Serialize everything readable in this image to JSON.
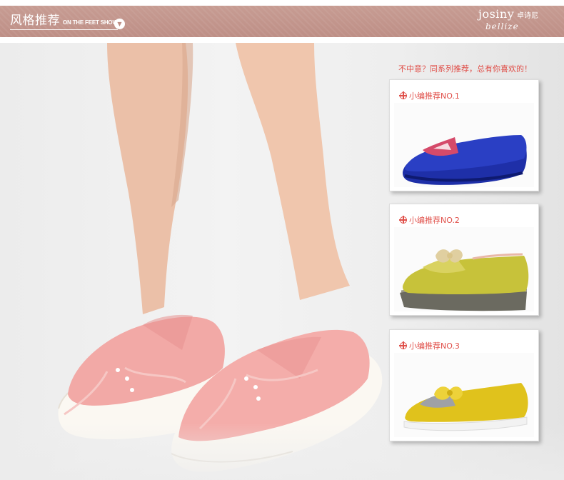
{
  "header": {
    "title": "风格推荐",
    "subtitle": "ON THE FEET SHOW",
    "arrow_icon": "chevron-down-icon",
    "brand_name": "JOSINY",
    "brand_cn": "卓诗尼",
    "brand_script": "bellize",
    "color": "#c49990"
  },
  "recommend": {
    "promo_text": "不中意？同系列推荐，总有你喜欢的！",
    "accent_color": "#e0504a",
    "cards": [
      {
        "label": "小编推荐NO.1",
        "shoe_color": "#2a3fc4"
      },
      {
        "label": "小编推荐NO.2",
        "shoe_color": "#c7c23a"
      },
      {
        "label": "小编推荐NO.3",
        "shoe_color": "#e0c21c"
      }
    ]
  },
  "hero": {
    "shoe_color": "#f2a9a6"
  }
}
